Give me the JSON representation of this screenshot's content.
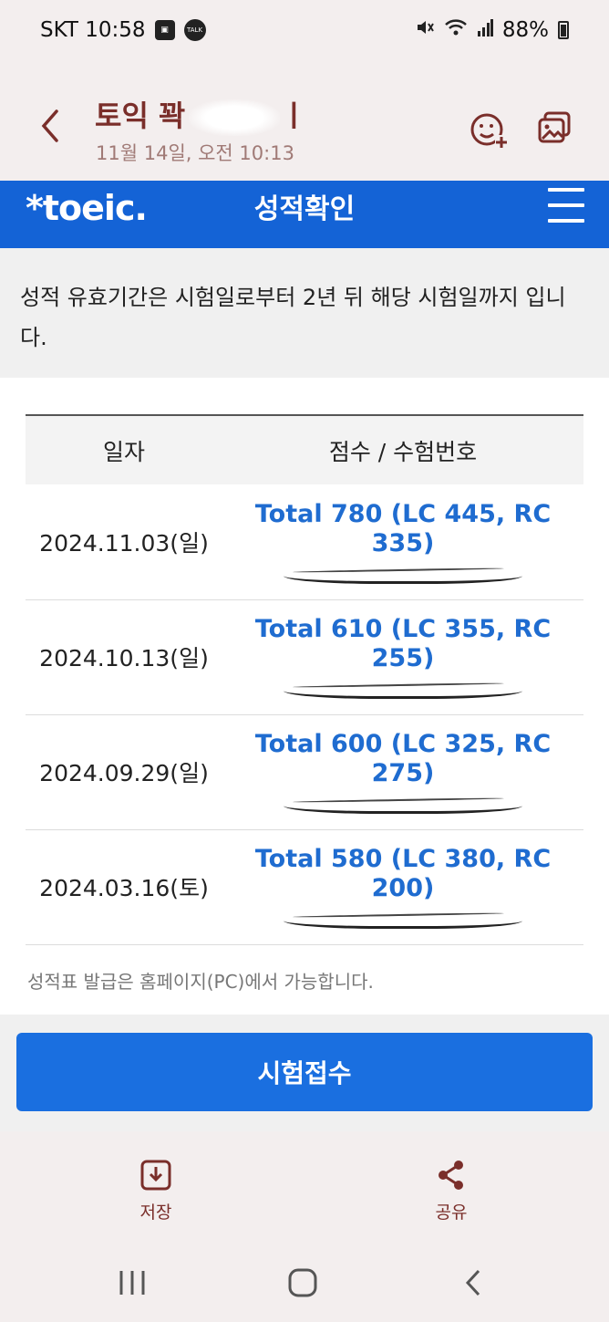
{
  "status_bar": {
    "carrier_time": "SKT 10:58",
    "battery": "88%",
    "icons": [
      "gallery-icon",
      "kakaotalk-icon",
      "mute-icon",
      "wifi-icon",
      "signal-icon",
      "battery-icon"
    ],
    "talk_label": "TALK"
  },
  "chat_header": {
    "title": "토익 꽉",
    "title_suffix": "ㅣ",
    "date": "11월 14일, 오전 10:13"
  },
  "toeic": {
    "logo": "*toeic.",
    "heading": "성적확인",
    "notice": "성적 유효기간은 시험일로부터 2년 뒤 해당 시험일까지 입니다.",
    "table": {
      "headers": [
        "일자",
        "점수 / 수험번호"
      ],
      "rows": [
        {
          "date": "2024.11.03(일)",
          "score": "Total 780 (LC 445, RC 335)"
        },
        {
          "date": "2024.10.13(일)",
          "score": "Total 610 (LC 355, RC 255)"
        },
        {
          "date": "2024.09.29(일)",
          "score": "Total 600 (LC 325, RC 275)"
        },
        {
          "date": "2024.03.16(토)",
          "score": "Total 580 (LC 380, RC 200)"
        }
      ]
    },
    "footnote": "성적표 발급은 홈페이지(PC)에서 가능합니다.",
    "apply_button": "시험접수"
  },
  "actions": {
    "save_label": "저장",
    "share_label": "공유"
  },
  "colors": {
    "brand_blue": "#1463d6",
    "score_blue": "#1f6cd0",
    "chat_accent": "#7a2e2a"
  }
}
